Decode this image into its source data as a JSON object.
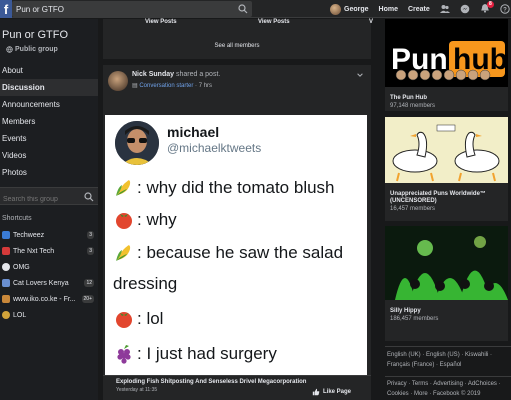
{
  "topbar": {
    "logo": "f",
    "search_value": "Pun or GTFO",
    "user_name": "George",
    "home": "Home",
    "create": "Create",
    "notif_count": "8"
  },
  "sidebar": {
    "group_name": "Pun or GTFO",
    "group_type": "Public group",
    "nav": [
      "About",
      "Discussion",
      "Announcements",
      "Members",
      "Events",
      "Videos",
      "Photos"
    ],
    "active": "Discussion",
    "search_placeholder": "Search this group",
    "shortcuts_heading": "Shortcuts",
    "shortcuts": [
      {
        "name": "Techweez",
        "count": "3",
        "color": "#3a7bd5"
      },
      {
        "name": "The Nxt Tech",
        "count": "3",
        "color": "#d53a3a"
      },
      {
        "name": "OMG",
        "count": "",
        "color": "#e4e6eb"
      },
      {
        "name": "Cat Lovers Kenya",
        "count": "12",
        "color": "#6a8fd0"
      },
      {
        "name": "www.iko.co.ke - Fr...",
        "count": "20+",
        "color": "#c9883a"
      },
      {
        "name": "LOL",
        "count": "",
        "color": "#d0a23a"
      }
    ]
  },
  "feed": {
    "suggest": {
      "view_posts_1": "View Posts",
      "view_posts_2": "View Posts",
      "view_posts_3": "V",
      "see_all": "See all members"
    },
    "post": {
      "author": "Nick Sunday",
      "action": "shared a post.",
      "badge": "Conversation starter",
      "time": "7 hrs",
      "tweet": {
        "name": "michael",
        "handle": "@michaelktweets",
        "lines": [
          {
            "emoji": "corn",
            "text": ": why did the tomato blush"
          },
          {
            "emoji": "tomato",
            "text": ": why"
          },
          {
            "emoji": "corn",
            "text": ": because he saw the salad"
          },
          {
            "emoji": "",
            "text": "dressing"
          },
          {
            "emoji": "tomato",
            "text": ": lol"
          },
          {
            "emoji": "grapes",
            "text": ": I just had surgery"
          }
        ]
      }
    },
    "related": {
      "title": "Exploding Fish Shitposting And Senseless Drivel Megacorporation",
      "time": "Yesterday at 11:35",
      "like": "Like Page"
    }
  },
  "right": {
    "groups": [
      {
        "name": "The Pun Hub",
        "members": "97,148 members"
      },
      {
        "name": "Unappreciated Puns Worldwide™ (UNCENSORED)",
        "members": "16,457 members"
      },
      {
        "name": "Silly Hippy",
        "members": "186,457 members"
      }
    ],
    "languages": "English (UK) · English (US) · Kiswahili · Français (France) · Español",
    "footer": "Privacy · Terms · Advertising · AdChoices · Cookies · More · Facebook © 2019"
  },
  "colors": {
    "topbar": "#242526",
    "bg": "#18191a",
    "card": "#242526",
    "link": "#6fa1e8",
    "alert": "#e41e3f"
  }
}
